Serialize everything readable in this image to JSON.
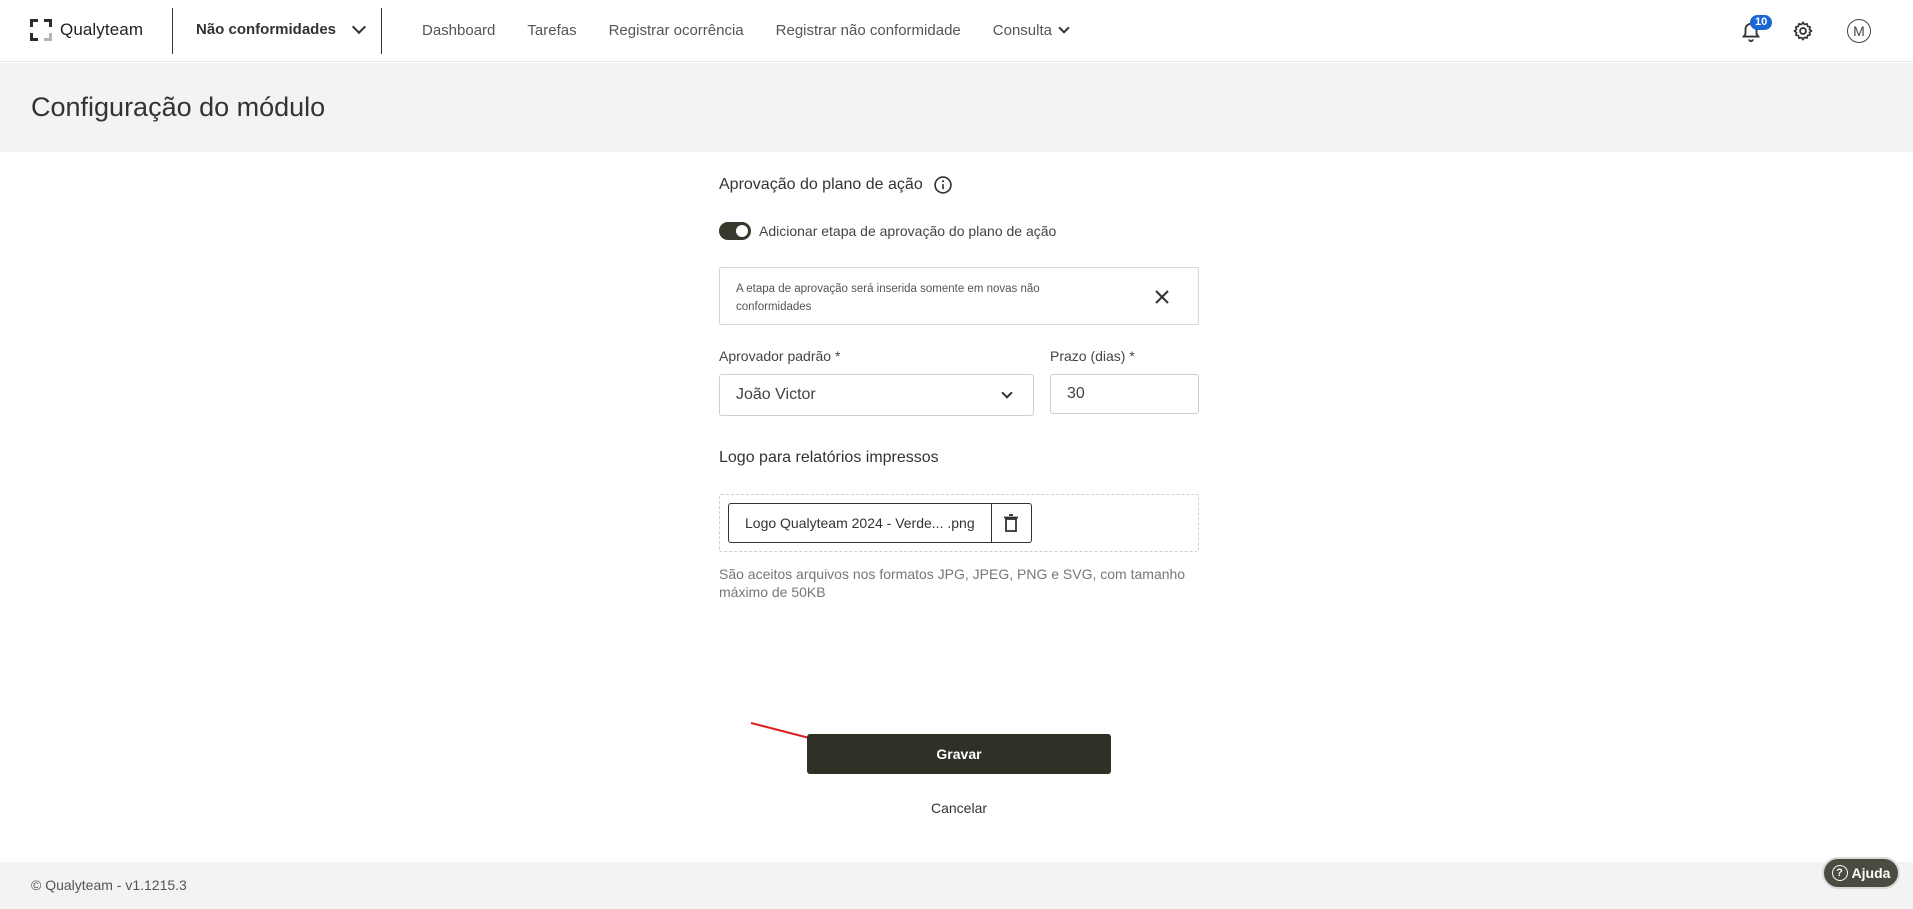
{
  "header": {
    "brand": "Qualyteam",
    "module_selector": "Não conformidades",
    "nav": [
      {
        "label": "Dashboard"
      },
      {
        "label": "Tarefas"
      },
      {
        "label": "Registrar ocorrência"
      },
      {
        "label": "Registrar não conformidade"
      },
      {
        "label": "Consulta"
      }
    ],
    "notification_count": "10",
    "avatar_initial": "M"
  },
  "page": {
    "title": "Configuração do módulo"
  },
  "approval": {
    "title": "Aprovação do plano de ação",
    "toggle_label": "Adicionar etapa de aprovação do plano de ação",
    "toggle_on": true,
    "alert_text": "A etapa de aprovação será inserida somente em novas não conformidades",
    "approver_label": "Aprovador padrão *",
    "approver_value": "João Victor",
    "deadline_label": "Prazo (dias) *",
    "deadline_value": "30"
  },
  "logo_section": {
    "title": "Logo para relatórios impressos",
    "file_name": "Logo Qualyteam 2024 - Verde... .png",
    "hint": "São aceitos arquivos nos formatos JPG, JPEG, PNG e SVG, com tamanho máximo de 50KB"
  },
  "actions": {
    "save_label": "Gravar",
    "cancel_label": "Cancelar"
  },
  "footer": {
    "copyright": "© Qualyteam - v1.1215.3",
    "help_label": "Ajuda"
  },
  "colors": {
    "primary_dark": "#2f3126",
    "badge_blue": "#1967d2",
    "annotation_arrow": "#e02020"
  }
}
